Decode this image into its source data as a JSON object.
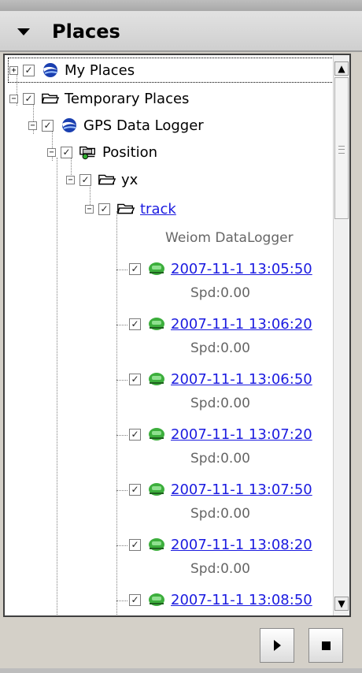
{
  "panel": {
    "title": "Places",
    "colors": {
      "header_bg": "#d8d8d8",
      "link": "#1b1be0",
      "tree_bg": "#ffffff",
      "track_icon": "#3cae3c"
    }
  },
  "tree": {
    "my_places": {
      "label": "My Places",
      "checked": true,
      "expander": "+"
    },
    "temporary_places": {
      "label": "Temporary Places",
      "checked": true,
      "expander": "−"
    },
    "gps_data_logger": {
      "label": "GPS Data Logger",
      "checked": true,
      "expander": "−"
    },
    "position": {
      "label": "Position",
      "checked": true,
      "expander": "−"
    },
    "yx": {
      "label": "yx",
      "checked": true,
      "expander": "−"
    },
    "track": {
      "label": "track",
      "checked": true,
      "expander": "−",
      "description": "Weiom DataLogger"
    },
    "points": [
      {
        "label": "2007-11-1 13:05:50",
        "desc": "Spd:0.00"
      },
      {
        "label": "2007-11-1 13:06:20",
        "desc": "Spd:0.00"
      },
      {
        "label": "2007-11-1 13:06:50",
        "desc": "Spd:0.00"
      },
      {
        "label": "2007-11-1 13:07:20",
        "desc": "Spd:0.00"
      },
      {
        "label": "2007-11-1 13:07:50",
        "desc": "Spd:0.00"
      },
      {
        "label": "2007-11-1 13:08:20",
        "desc": "Spd:0.00"
      },
      {
        "label": "2007-11-1 13:08:50",
        "desc": ""
      }
    ]
  },
  "icons": {
    "collapse": "triangle-down-icon",
    "play": "play-icon",
    "stop": "stop-icon",
    "scroll_up": "scroll-up-arrow-icon",
    "scroll_down": "scroll-down-arrow-icon"
  }
}
